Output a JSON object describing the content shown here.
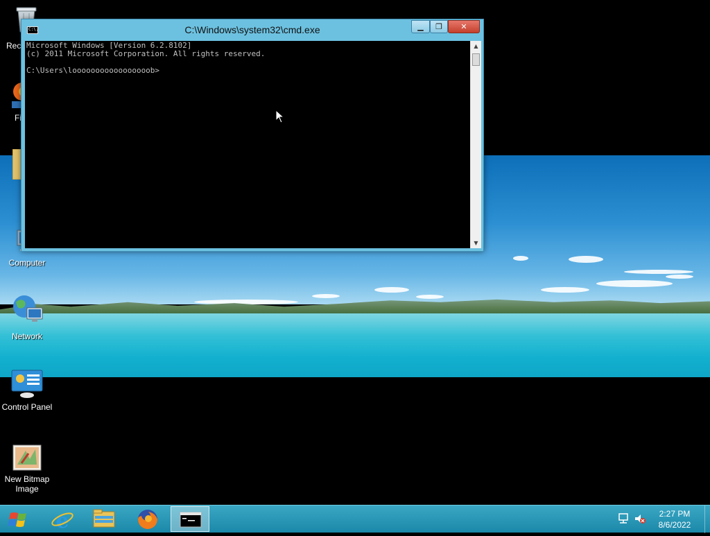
{
  "desktop": {
    "icons": [
      {
        "label": "Computer"
      },
      {
        "label": "Network"
      },
      {
        "label": "Control Panel"
      },
      {
        "label": "New Bitmap Image"
      }
    ],
    "partial_labels": [
      "Rec",
      "Fi"
    ]
  },
  "cmd_window": {
    "title": "C:\\Windows\\system32\\cmd.exe",
    "title_icon_text": "C:\\.",
    "min_glyph": "▁",
    "max_glyph": "❐",
    "close_glyph": "✕",
    "console_lines": [
      "Microsoft Windows [Version 6.2.8102]",
      "(c) 2011 Microsoft Corporation. All rights reserved.",
      "",
      "C:\\Users\\looooooooooooooooob>"
    ],
    "scroll_up": "▲",
    "scroll_down": "▼"
  },
  "taskbar": {
    "clock_time": "2:27 PM",
    "clock_date": "8/6/2022"
  }
}
